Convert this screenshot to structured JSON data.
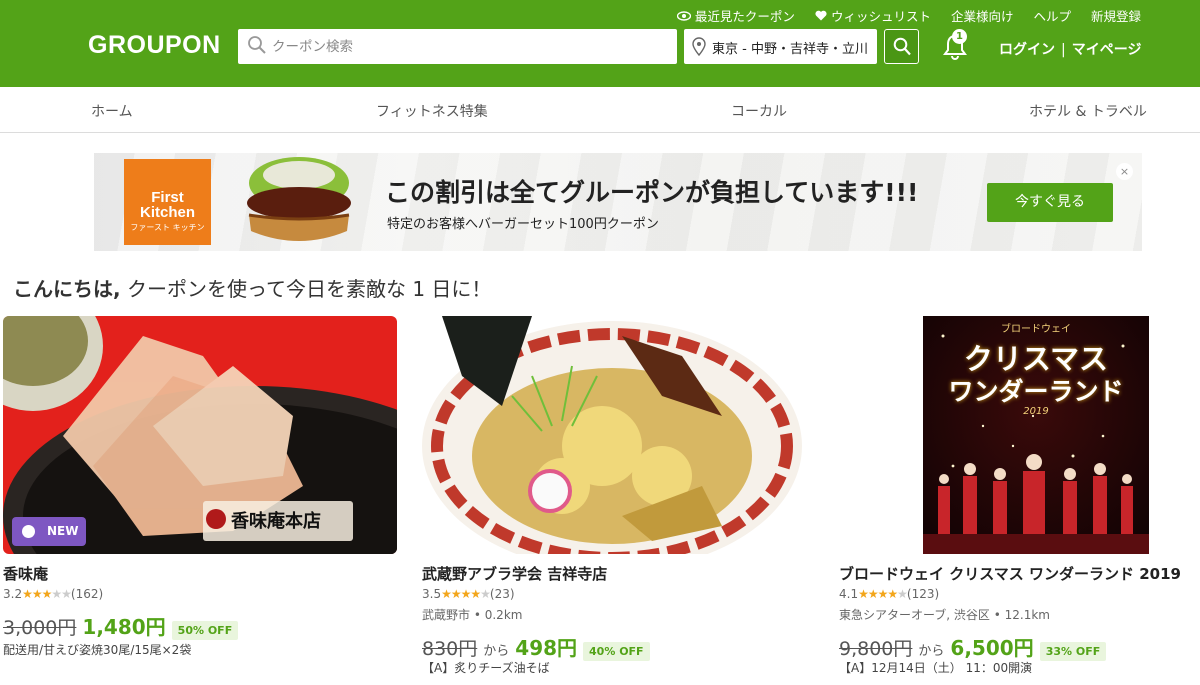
{
  "header": {
    "logo": "GROUPON",
    "links": [
      {
        "label": "最近見たクーポン",
        "icon": "eye-icon"
      },
      {
        "label": "ウィッシュリスト",
        "icon": "heart-icon"
      },
      {
        "label": "企業様向け"
      },
      {
        "label": "ヘルプ"
      },
      {
        "label": "新規登録"
      }
    ],
    "search_placeholder": "クーポン検索",
    "location": "東京 - 中野・吉祥寺・立川",
    "notification_count": "1",
    "login": "ログイン",
    "mypage": "マイページ",
    "separator": "|"
  },
  "nav": {
    "items": [
      "ホーム",
      "フィットネス特集",
      "コーカル",
      "ホテル & トラベル"
    ]
  },
  "banner": {
    "brand_line1": "First",
    "brand_line2": "Kitchen",
    "brand_sub": "ファースト キッチン",
    "title": "この割引は全てグルーポンが負担しています!!!",
    "subtitle": "特定のお客様へバーガーセット100円クーポン",
    "button": "今すぐ見る",
    "close": "×"
  },
  "greeting": {
    "bold": "こんにちは,",
    "rest": " クーポンを使って今日を素敵な 1 日に！"
  },
  "deals": [
    {
      "title": "香味庵",
      "rating": "3.2",
      "stars": 3.2,
      "reviews": "(162)",
      "badge": "NEW",
      "shop_text": "香味庵本店",
      "original_price": "3,000円",
      "price": "1,480円",
      "discount": "50% OFF",
      "description": "配送用/甘えび姿焼30尾/15尾×2袋"
    },
    {
      "title": "武蔵野アブラ学会 吉祥寺店",
      "rating": "3.5",
      "stars": 3.5,
      "reviews": "(23)",
      "location": "武蔵野市",
      "distance": "0.2km",
      "original_price": "830円",
      "from": "から",
      "price": "498円",
      "discount": "40% OFF",
      "description": "【A】炙りチーズ油そば"
    },
    {
      "title": "ブロードウェイ クリスマス ワンダーランド 2019",
      "rating": "4.1",
      "stars": 4.1,
      "reviews": "(123)",
      "location": "東急シアターオーブ, 渋谷区",
      "distance": "12.1km",
      "original_price": "9,800円",
      "from": "から",
      "price": "6,500円",
      "discount": "33% OFF",
      "description": "【A】12月14日（土） 11：00開演",
      "poster_top": "ブロードウェイ",
      "poster_line1": "クリスマス",
      "poster_line2": "ワンダーランド",
      "poster_year": "2019"
    }
  ],
  "colors": {
    "brand_green": "#53a318",
    "star": "#f3a61b",
    "new_badge": "#7e57c2"
  }
}
